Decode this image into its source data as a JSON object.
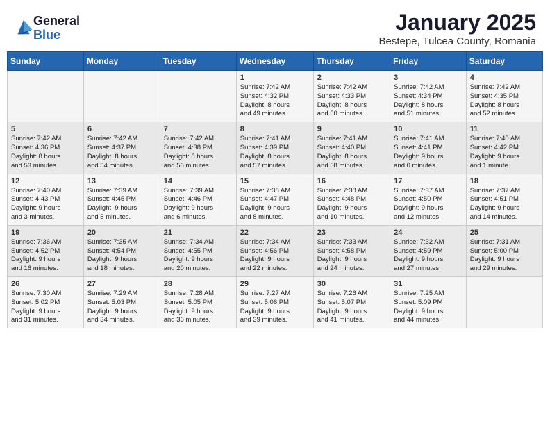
{
  "header": {
    "logo_general": "General",
    "logo_blue": "Blue",
    "month": "January 2025",
    "location": "Bestepe, Tulcea County, Romania"
  },
  "days_of_week": [
    "Sunday",
    "Monday",
    "Tuesday",
    "Wednesday",
    "Thursday",
    "Friday",
    "Saturday"
  ],
  "weeks": [
    [
      {
        "day": "",
        "content": ""
      },
      {
        "day": "",
        "content": ""
      },
      {
        "day": "",
        "content": ""
      },
      {
        "day": "1",
        "content": "Sunrise: 7:42 AM\nSunset: 4:32 PM\nDaylight: 8 hours\nand 49 minutes."
      },
      {
        "day": "2",
        "content": "Sunrise: 7:42 AM\nSunset: 4:33 PM\nDaylight: 8 hours\nand 50 minutes."
      },
      {
        "day": "3",
        "content": "Sunrise: 7:42 AM\nSunset: 4:34 PM\nDaylight: 8 hours\nand 51 minutes."
      },
      {
        "day": "4",
        "content": "Sunrise: 7:42 AM\nSunset: 4:35 PM\nDaylight: 8 hours\nand 52 minutes."
      }
    ],
    [
      {
        "day": "5",
        "content": "Sunrise: 7:42 AM\nSunset: 4:36 PM\nDaylight: 8 hours\nand 53 minutes."
      },
      {
        "day": "6",
        "content": "Sunrise: 7:42 AM\nSunset: 4:37 PM\nDaylight: 8 hours\nand 54 minutes."
      },
      {
        "day": "7",
        "content": "Sunrise: 7:42 AM\nSunset: 4:38 PM\nDaylight: 8 hours\nand 56 minutes."
      },
      {
        "day": "8",
        "content": "Sunrise: 7:41 AM\nSunset: 4:39 PM\nDaylight: 8 hours\nand 57 minutes."
      },
      {
        "day": "9",
        "content": "Sunrise: 7:41 AM\nSunset: 4:40 PM\nDaylight: 8 hours\nand 58 minutes."
      },
      {
        "day": "10",
        "content": "Sunrise: 7:41 AM\nSunset: 4:41 PM\nDaylight: 9 hours\nand 0 minutes."
      },
      {
        "day": "11",
        "content": "Sunrise: 7:40 AM\nSunset: 4:42 PM\nDaylight: 9 hours\nand 1 minute."
      }
    ],
    [
      {
        "day": "12",
        "content": "Sunrise: 7:40 AM\nSunset: 4:43 PM\nDaylight: 9 hours\nand 3 minutes."
      },
      {
        "day": "13",
        "content": "Sunrise: 7:39 AM\nSunset: 4:45 PM\nDaylight: 9 hours\nand 5 minutes."
      },
      {
        "day": "14",
        "content": "Sunrise: 7:39 AM\nSunset: 4:46 PM\nDaylight: 9 hours\nand 6 minutes."
      },
      {
        "day": "15",
        "content": "Sunrise: 7:38 AM\nSunset: 4:47 PM\nDaylight: 9 hours\nand 8 minutes."
      },
      {
        "day": "16",
        "content": "Sunrise: 7:38 AM\nSunset: 4:48 PM\nDaylight: 9 hours\nand 10 minutes."
      },
      {
        "day": "17",
        "content": "Sunrise: 7:37 AM\nSunset: 4:50 PM\nDaylight: 9 hours\nand 12 minutes."
      },
      {
        "day": "18",
        "content": "Sunrise: 7:37 AM\nSunset: 4:51 PM\nDaylight: 9 hours\nand 14 minutes."
      }
    ],
    [
      {
        "day": "19",
        "content": "Sunrise: 7:36 AM\nSunset: 4:52 PM\nDaylight: 9 hours\nand 16 minutes."
      },
      {
        "day": "20",
        "content": "Sunrise: 7:35 AM\nSunset: 4:54 PM\nDaylight: 9 hours\nand 18 minutes."
      },
      {
        "day": "21",
        "content": "Sunrise: 7:34 AM\nSunset: 4:55 PM\nDaylight: 9 hours\nand 20 minutes."
      },
      {
        "day": "22",
        "content": "Sunrise: 7:34 AM\nSunset: 4:56 PM\nDaylight: 9 hours\nand 22 minutes."
      },
      {
        "day": "23",
        "content": "Sunrise: 7:33 AM\nSunset: 4:58 PM\nDaylight: 9 hours\nand 24 minutes."
      },
      {
        "day": "24",
        "content": "Sunrise: 7:32 AM\nSunset: 4:59 PM\nDaylight: 9 hours\nand 27 minutes."
      },
      {
        "day": "25",
        "content": "Sunrise: 7:31 AM\nSunset: 5:00 PM\nDaylight: 9 hours\nand 29 minutes."
      }
    ],
    [
      {
        "day": "26",
        "content": "Sunrise: 7:30 AM\nSunset: 5:02 PM\nDaylight: 9 hours\nand 31 minutes."
      },
      {
        "day": "27",
        "content": "Sunrise: 7:29 AM\nSunset: 5:03 PM\nDaylight: 9 hours\nand 34 minutes."
      },
      {
        "day": "28",
        "content": "Sunrise: 7:28 AM\nSunset: 5:05 PM\nDaylight: 9 hours\nand 36 minutes."
      },
      {
        "day": "29",
        "content": "Sunrise: 7:27 AM\nSunset: 5:06 PM\nDaylight: 9 hours\nand 39 minutes."
      },
      {
        "day": "30",
        "content": "Sunrise: 7:26 AM\nSunset: 5:07 PM\nDaylight: 9 hours\nand 41 minutes."
      },
      {
        "day": "31",
        "content": "Sunrise: 7:25 AM\nSunset: 5:09 PM\nDaylight: 9 hours\nand 44 minutes."
      },
      {
        "day": "",
        "content": ""
      }
    ]
  ]
}
